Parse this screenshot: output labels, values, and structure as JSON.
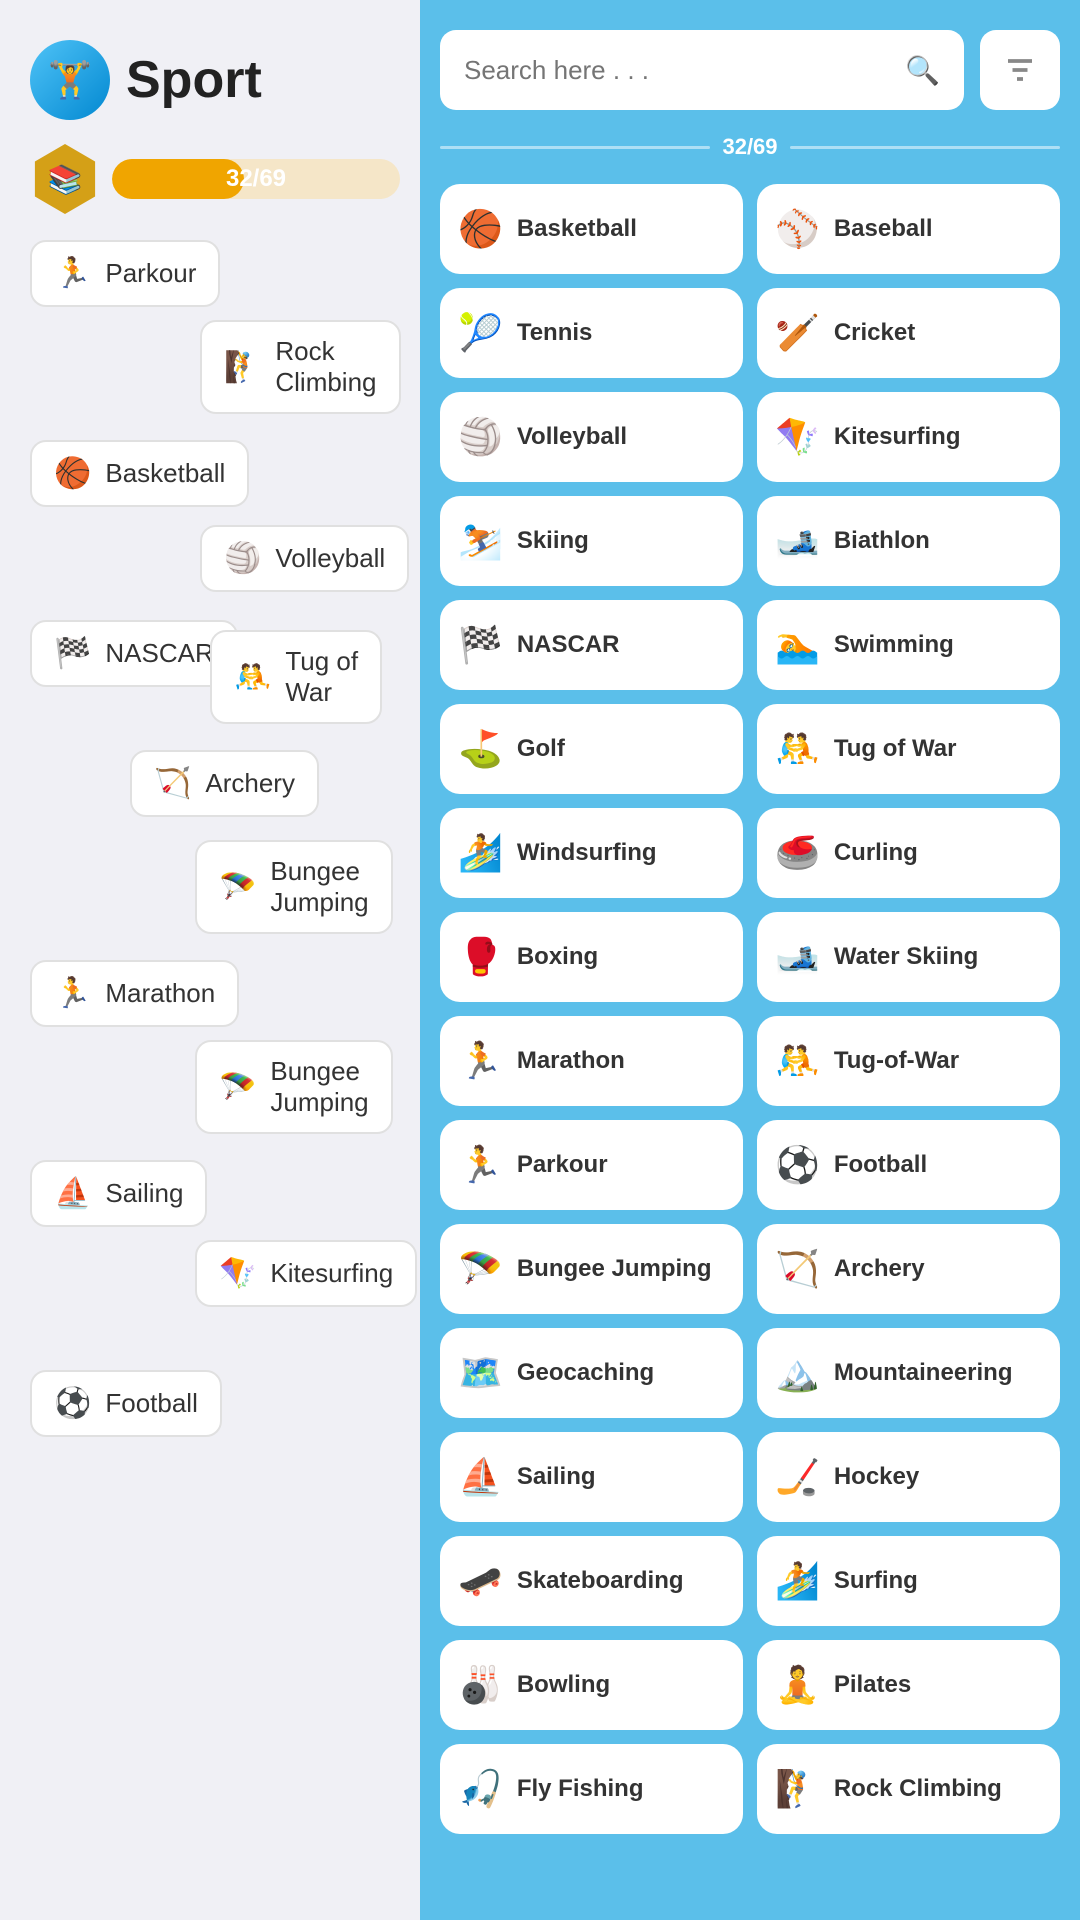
{
  "app": {
    "title": "Sport",
    "icon_emoji": "🏋️",
    "progress_current": 32,
    "progress_total": 69,
    "progress_label": "32/69"
  },
  "search": {
    "placeholder": "Search here . . .",
    "filter_icon": "⊟",
    "progress_label": "32/69"
  },
  "left_sports": [
    {
      "id": "parkour-left",
      "label": "Parkour",
      "emoji": "🏃"
    },
    {
      "id": "rock-climbing-left",
      "label": "Rock Climbing",
      "emoji": "🧗"
    },
    {
      "id": "basketball-left",
      "label": "Basketball",
      "emoji": "🏀"
    },
    {
      "id": "volleyball-left",
      "label": "Volleyball",
      "emoji": "🏐"
    },
    {
      "id": "nascar-left",
      "label": "NASCAR",
      "emoji": "🏁"
    },
    {
      "id": "tug-of-war-left",
      "label": "Tug of War",
      "emoji": "🤼"
    },
    {
      "id": "archery-left",
      "label": "Archery",
      "emoji": "🏹"
    },
    {
      "id": "bungee-jumping-left",
      "label": "Bungee Jumping",
      "emoji": "🪂"
    },
    {
      "id": "marathon-left",
      "label": "Marathon",
      "emoji": "🏃"
    },
    {
      "id": "bungee-jumping2-left",
      "label": "Bungee Jumping",
      "emoji": "🪂"
    },
    {
      "id": "sailing-left",
      "label": "Sailing",
      "emoji": "⛵"
    },
    {
      "id": "kitesurfing-left",
      "label": "Kitesurfing",
      "emoji": "🪁"
    },
    {
      "id": "football-left",
      "label": "Football",
      "emoji": "⚽"
    }
  ],
  "right_sports": [
    {
      "id": "basketball",
      "label": "Basketball",
      "emoji": "🏀"
    },
    {
      "id": "baseball",
      "label": "Baseball",
      "emoji": "⚾"
    },
    {
      "id": "tennis",
      "label": "Tennis",
      "emoji": "🎾"
    },
    {
      "id": "cricket",
      "label": "Cricket",
      "emoji": "🏏"
    },
    {
      "id": "volleyball",
      "label": "Volleyball",
      "emoji": "🏐"
    },
    {
      "id": "kitesurfing",
      "label": "Kitesurfing",
      "emoji": "🪁"
    },
    {
      "id": "skiing",
      "label": "Skiing",
      "emoji": "⛷️"
    },
    {
      "id": "biathlon",
      "label": "Biathlon",
      "emoji": "🎿"
    },
    {
      "id": "nascar",
      "label": "NASCAR",
      "emoji": "🏁"
    },
    {
      "id": "swimming",
      "label": "Swimming",
      "emoji": "🏊"
    },
    {
      "id": "golf",
      "label": "Golf",
      "emoji": "⛳"
    },
    {
      "id": "tug-of-war",
      "label": "Tug of War",
      "emoji": "🤼"
    },
    {
      "id": "windsurfing",
      "label": "Windsurfing",
      "emoji": "🏄"
    },
    {
      "id": "curling",
      "label": "Curling",
      "emoji": "🥌"
    },
    {
      "id": "boxing",
      "label": "Boxing",
      "emoji": "🥊"
    },
    {
      "id": "water-skiing",
      "label": "Water Skiing",
      "emoji": "🎿"
    },
    {
      "id": "marathon",
      "label": "Marathon",
      "emoji": "🏃"
    },
    {
      "id": "tug-of-war2",
      "label": "Tug-of-War",
      "emoji": "🤼"
    },
    {
      "id": "parkour",
      "label": "Parkour",
      "emoji": "🏃"
    },
    {
      "id": "football",
      "label": "Football",
      "emoji": "⚽"
    },
    {
      "id": "bungee-jumping",
      "label": "Bungee Jumping",
      "emoji": "🪂"
    },
    {
      "id": "archery",
      "label": "Archery",
      "emoji": "🏹"
    },
    {
      "id": "geocaching",
      "label": "Geocaching",
      "emoji": "🗺️"
    },
    {
      "id": "mountaineering",
      "label": "Mountaineering",
      "emoji": "🏔️"
    },
    {
      "id": "sailing",
      "label": "Sailing",
      "emoji": "⛵"
    },
    {
      "id": "hockey",
      "label": "Hockey",
      "emoji": "🏒"
    },
    {
      "id": "skateboarding",
      "label": "Skateboarding",
      "emoji": "🛹"
    },
    {
      "id": "surfing",
      "label": "Surfing",
      "emoji": "🏄"
    },
    {
      "id": "bowling",
      "label": "Bowling",
      "emoji": "🎳"
    },
    {
      "id": "pilates",
      "label": "Pilates",
      "emoji": "🧘"
    },
    {
      "id": "fly-fishing",
      "label": "Fly Fishing",
      "emoji": "🎣"
    },
    {
      "id": "rock-climbing",
      "label": "Rock Climbing",
      "emoji": "🧗"
    }
  ]
}
